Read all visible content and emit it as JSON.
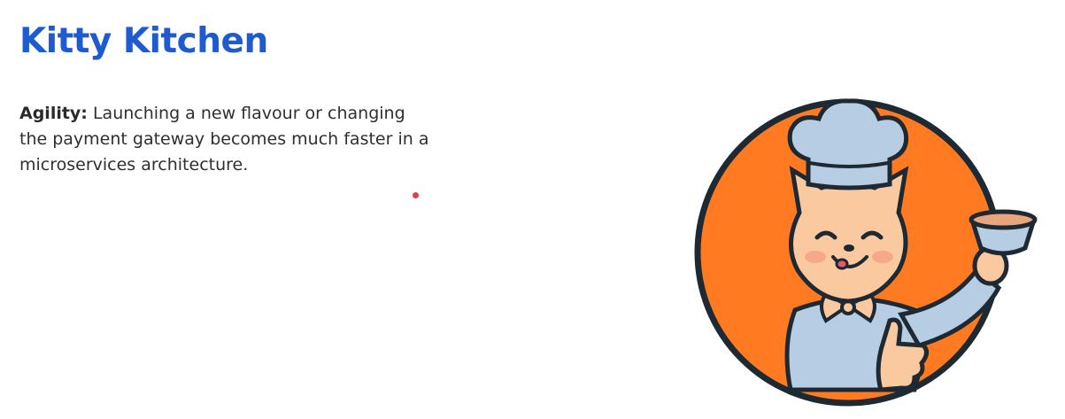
{
  "slide": {
    "title": "Kitty Kitchen",
    "point": {
      "lead": "Agility:",
      "text": " Launching a new flavour or changing the payment gateway becomes much faster in a microservices architecture."
    }
  },
  "colors": {
    "title": "#1f5bd0",
    "circle_fill": "#ff7a21",
    "outline": "#1d2a33",
    "fur": "#fbc9a0",
    "uniform": "#b6cde3",
    "pointer_dot": "#e0404a"
  },
  "illustration": {
    "subject": "cat-chef-icon"
  }
}
